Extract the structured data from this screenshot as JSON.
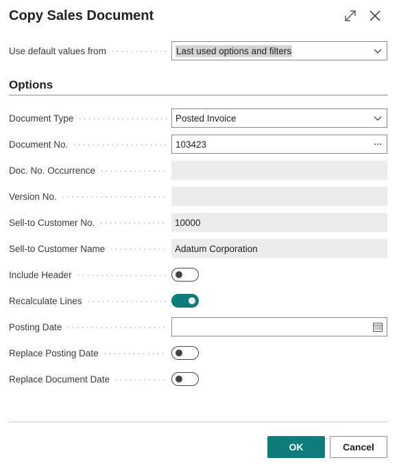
{
  "dialog": {
    "title": "Copy Sales Document",
    "expand_icon": "expand-icon",
    "close_icon": "close-icon"
  },
  "defaults": {
    "label": "Use default values from",
    "value": "Last used options and filters"
  },
  "options": {
    "heading": "Options",
    "document_type": {
      "label": "Document Type",
      "value": "Posted Invoice"
    },
    "document_no": {
      "label": "Document No.",
      "value": "103423"
    },
    "doc_no_occurrence": {
      "label": "Doc. No. Occurrence",
      "value": ""
    },
    "version_no": {
      "label": "Version No.",
      "value": ""
    },
    "sell_to_customer_no": {
      "label": "Sell-to Customer No.",
      "value": "10000"
    },
    "sell_to_customer_name": {
      "label": "Sell-to Customer Name",
      "value": "Adatum Corporation"
    },
    "include_header": {
      "label": "Include Header",
      "on": false
    },
    "recalculate_lines": {
      "label": "Recalculate Lines",
      "on": true
    },
    "posting_date": {
      "label": "Posting Date",
      "value": ""
    },
    "replace_posting_date": {
      "label": "Replace Posting Date",
      "on": false
    },
    "replace_document_date": {
      "label": "Replace Document Date",
      "on": false
    }
  },
  "footer": {
    "ok_label": "OK",
    "cancel_label": "Cancel"
  },
  "colors": {
    "accent": "#0e7c7b"
  }
}
